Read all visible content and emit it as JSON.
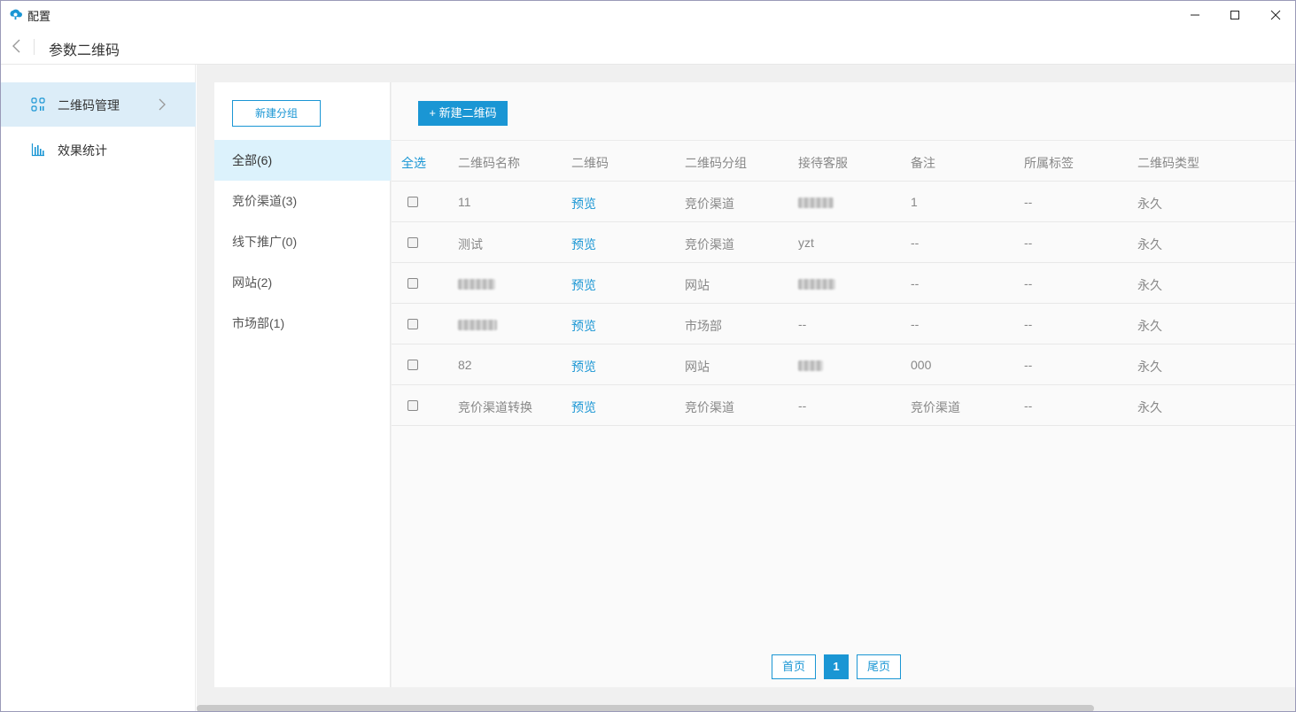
{
  "window": {
    "title": "配置"
  },
  "header": {
    "title": "参数二维码"
  },
  "sidebar": {
    "items": [
      {
        "label": "二维码管理",
        "icon": "qr-code-icon",
        "active": true
      },
      {
        "label": "效果统计",
        "icon": "bar-chart-icon",
        "active": false
      }
    ]
  },
  "groups": {
    "new_group_label": "新建分组",
    "items": [
      {
        "label": "全部(6)",
        "active": true
      },
      {
        "label": "竞价渠道(3)",
        "active": false
      },
      {
        "label": "线下推广(0)",
        "active": false
      },
      {
        "label": "网站(2)",
        "active": false
      },
      {
        "label": "市场部(1)",
        "active": false
      }
    ]
  },
  "toolbar": {
    "new_qr_label": "+ 新建二维码"
  },
  "table": {
    "headers": [
      "全选",
      "二维码名称",
      "二维码",
      "二维码分组",
      "接待客服",
      "备注",
      "所属标签",
      "二维码类型"
    ],
    "rows": [
      {
        "name": "11",
        "qr": "预览",
        "group": "竞价渠道",
        "agent": "",
        "note": "1",
        "tag": "--",
        "type": "永久"
      },
      {
        "name": "测试",
        "qr": "预览",
        "group": "竞价渠道",
        "agent": "yzt",
        "note": "--",
        "tag": "--",
        "type": "永久"
      },
      {
        "name": "",
        "qr": "预览",
        "group": "网站",
        "agent": "",
        "note": "--",
        "tag": "--",
        "type": "永久"
      },
      {
        "name": "",
        "qr": "预览",
        "group": "市场部",
        "agent": "--",
        "note": "--",
        "tag": "--",
        "type": "永久"
      },
      {
        "name": "82",
        "qr": "预览",
        "group": "网站",
        "agent": "",
        "note": "000",
        "tag": "--",
        "type": "永久"
      },
      {
        "name": "竞价渠道转换",
        "qr": "预览",
        "group": "竞价渠道",
        "agent": "--",
        "note": "竞价渠道",
        "tag": "--",
        "type": "永久"
      }
    ]
  },
  "pagination": {
    "first": "首页",
    "current": "1",
    "last": "尾页"
  },
  "colors": {
    "accent": "#1a96d4",
    "active_nav_bg": "#dcedf8",
    "active_group_bg": "#dcf2fc"
  }
}
